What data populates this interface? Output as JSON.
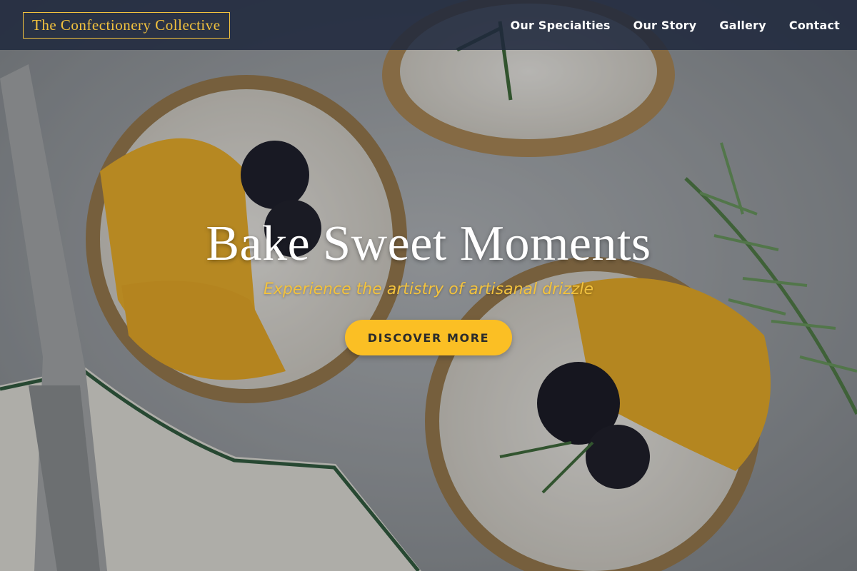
{
  "header": {
    "logo_text": "The Confectionery Collective",
    "nav": [
      {
        "label": "Our Specialties"
      },
      {
        "label": "Our Story"
      },
      {
        "label": "Gallery"
      },
      {
        "label": "Contact"
      }
    ]
  },
  "hero": {
    "title": "Bake Sweet Moments",
    "subtitle": "Experience the artistry of artisanal drizzle",
    "cta_label": "DISCOVER MORE",
    "background_image": "tarts-with-orange-blackberries-rosemary"
  },
  "colors": {
    "header_bg": "#1e283c",
    "accent_gold": "#f2c23e",
    "button_yellow": "#fbbf24",
    "text_white": "#ffffff"
  }
}
